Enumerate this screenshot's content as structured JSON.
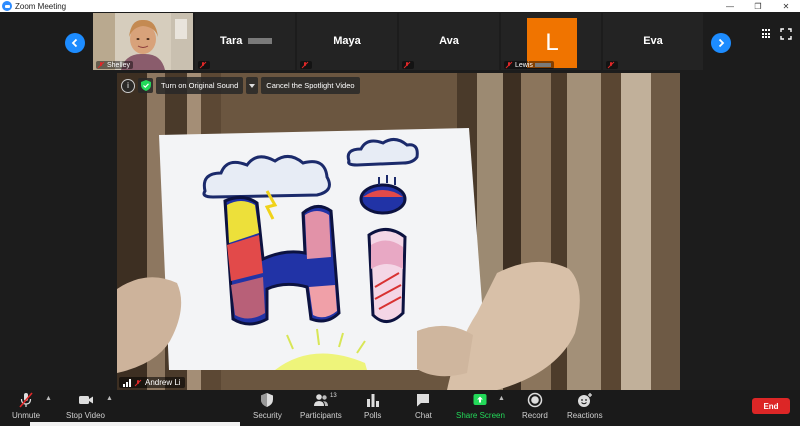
{
  "window": {
    "title": "Zoom Meeting",
    "controls": [
      "—",
      "❐",
      "✕"
    ]
  },
  "gallery": {
    "prev_icon": "chevron-left-icon",
    "next_icon": "chevron-right-icon",
    "tiles": [
      {
        "name": "Shelley",
        "type": "video"
      },
      {
        "name": "Tara",
        "type": "name"
      },
      {
        "name": "Maya",
        "type": "name"
      },
      {
        "name": "Ava",
        "type": "name"
      },
      {
        "name": "Lewis",
        "type": "avatar",
        "avatar_letter": "L",
        "avatar_color": "#f07400"
      },
      {
        "name": "Eva",
        "type": "name"
      }
    ]
  },
  "main_video": {
    "speaker": "Andrew Li",
    "buttons": {
      "original_sound": "Turn on Original Sound",
      "cancel_spotlight": "Cancel the Spotlight Video"
    },
    "drawing_text": "Hi"
  },
  "toolbar": {
    "unmute": "Unmute",
    "stop_video": "Stop Video",
    "security": "Security",
    "participants": "Participants",
    "participants_count": "13",
    "polls": "Polls",
    "chat": "Chat",
    "share_screen": "Share Screen",
    "record": "Record",
    "reactions": "Reactions",
    "end": "End"
  },
  "colors": {
    "accent": "#1d8cff",
    "share_green": "#23d959",
    "end_red": "#dc2626",
    "muted_red": "#e02828"
  }
}
